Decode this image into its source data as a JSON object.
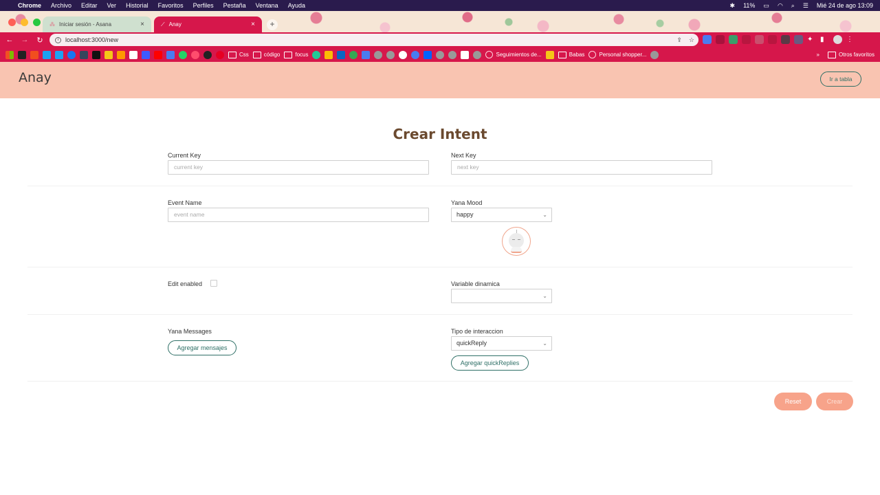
{
  "menubar": {
    "app": "Chrome",
    "menus": [
      "Archivo",
      "Editar",
      "Ver",
      "Historial",
      "Favoritos",
      "Perfiles",
      "Pestaña",
      "Ventana",
      "Ayuda"
    ],
    "battery": "11%",
    "datetime": "Mié 24 de ago  13:09"
  },
  "tabs": [
    {
      "title": "Iniciar sesión - Asana",
      "active": false
    },
    {
      "title": "Anay",
      "active": true
    }
  ],
  "omnibox": {
    "url": "localhost:3000/new"
  },
  "bookmarks": {
    "folders": [
      "Css",
      "código",
      "focus"
    ],
    "links": [
      "Seguimientos de...",
      "Babas",
      "Personal shopper..."
    ],
    "more": "»",
    "others": "Otros favoritos"
  },
  "app": {
    "brand": "Anay",
    "nav_button": "Ir a tabla",
    "page_title": "Crear Intent"
  },
  "form": {
    "current_key": {
      "label": "Current Key",
      "placeholder": "current key"
    },
    "next_key": {
      "label": "Next Key",
      "placeholder": "next key"
    },
    "event_name": {
      "label": "Event Name",
      "placeholder": "event name"
    },
    "yana_mood": {
      "label": "Yana Mood",
      "value": "happy"
    },
    "edit_enabled": {
      "label": "Edit enabled",
      "checked": false
    },
    "variable_dinamica": {
      "label": "Variable dinamica",
      "value": ""
    },
    "yana_messages": {
      "label": "Yana Messages",
      "button": "Agregar mensajes"
    },
    "tipo_interaccion": {
      "label": "Tipo de interaccion",
      "value": "quickReply",
      "button": "Agregar quickReplies"
    }
  },
  "actions": {
    "reset": "Reset",
    "crear": "Crear"
  },
  "colors": {
    "accent": "#d6174b",
    "header_bg": "#f9c4b1",
    "teal": "#2e6f66",
    "title": "#6b4a2f",
    "button": "#f7a38a"
  }
}
